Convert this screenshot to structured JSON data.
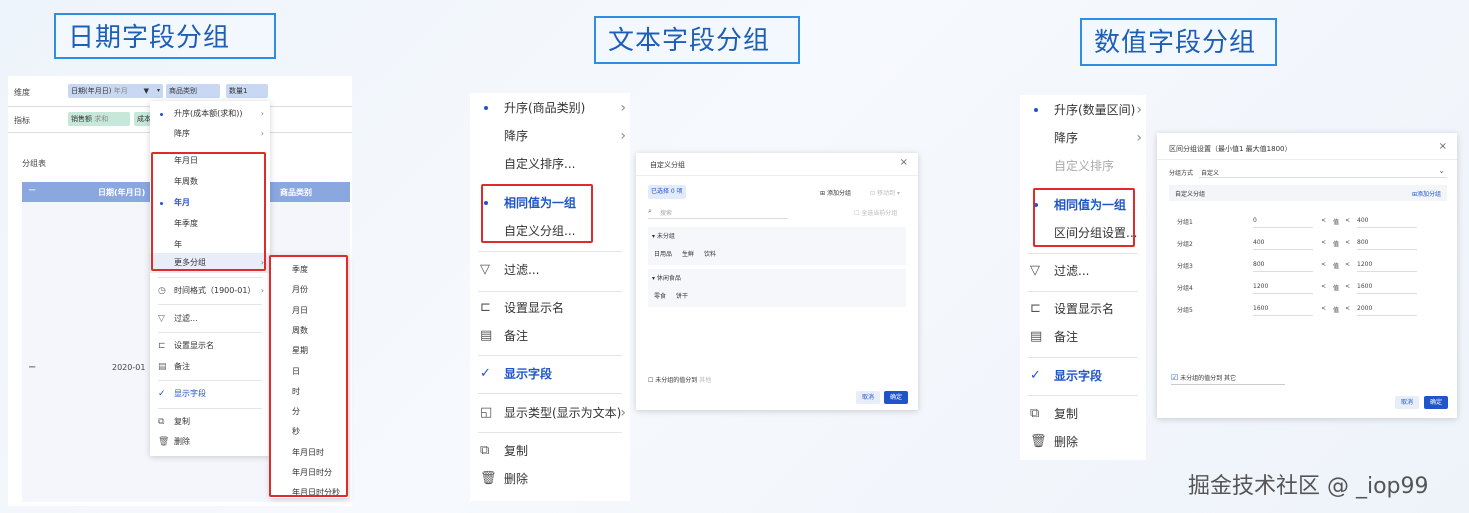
{
  "titles": {
    "date": "日期字段分组",
    "text": "文本字段分组",
    "number": "数值字段分组"
  },
  "watermark": "掘金技术社区 @ _iop99",
  "date_panel": {
    "dim_label": "维度",
    "measure_label": "指标",
    "field_date": "日期(年月日)",
    "field_date_sub": "年月",
    "field_cat": "商品类别",
    "field_qty": "数量1",
    "measure_sales": "销售额",
    "measure_sales_sub": "求和",
    "measure_cost": "成本",
    "group_table": "分组表",
    "table_minus": "−",
    "table_col1": "日期(年月日)",
    "table_col2": "商品类别",
    "row_minus": "−",
    "row_value": "2020-01",
    "menu": {
      "asc": "升序(成本额(求和))",
      "desc": "降序",
      "ymd": "年月日",
      "yw": "年周数",
      "ym": "年月",
      "yq": "年季度",
      "y": "年",
      "more": "更多分组",
      "time_fmt": "时间格式（1900-01）",
      "filter": "过滤...",
      "set_name": "设置显示名",
      "note": "备注",
      "show": "显示字段",
      "copy": "复制",
      "delete": "删除"
    },
    "submenu": [
      "季度",
      "月份",
      "月日",
      "周数",
      "星期",
      "日",
      "时",
      "分",
      "秒",
      "年月日时",
      "年月日时分",
      "年月日时分秒"
    ]
  },
  "text_panel": {
    "menu": {
      "asc": "升序(商品类别)",
      "desc": "降序",
      "custom_sort": "自定义排序...",
      "same_value": "相同值为一组",
      "custom_group": "自定义分组...",
      "filter": "过滤...",
      "set_name": "设置显示名",
      "note": "备注",
      "show": "显示字段",
      "display_type": "显示类型(显示为文本)",
      "copy": "复制",
      "delete": "删除"
    },
    "dialog": {
      "title": "自定义分组",
      "close": "×",
      "selected": "已选择 0 项",
      "add_group": "添加分组",
      "move_to": "移动到",
      "search_placeholder": "搜索",
      "select_all": "全选当前分组",
      "group1_name": "未分组",
      "group1_items": [
        "日用品",
        "生鲜",
        "饮料"
      ],
      "group2_name": "休闲食品",
      "group2_items": [
        "零食",
        "饼干"
      ],
      "ungrouped_check": "未分组的值分到",
      "ungrouped_value": "其他",
      "cancel": "取消",
      "ok": "确定"
    }
  },
  "number_panel": {
    "menu": {
      "asc": "升序(数量区间)",
      "desc": "降序",
      "custom_sort": "自定义排序",
      "same_value": "相同值为一组",
      "range_group": "区间分组设置...",
      "filter": "过滤...",
      "set_name": "设置显示名",
      "note": "备注",
      "show": "显示字段",
      "copy": "复制",
      "delete": "删除"
    },
    "dialog": {
      "title": "区间分组设置（最小值1 最大值1800）",
      "close": "×",
      "method_label": "分组方式",
      "method_value": "自定义",
      "custom_label": "自定义分组",
      "add_group": "添加分组",
      "rows": [
        {
          "name": "分组1",
          "from": "0",
          "op1": "<",
          "mid": "值",
          "op2": "<",
          "to": "400"
        },
        {
          "name": "分组2",
          "from": "400",
          "op1": "<",
          "mid": "值",
          "op2": "<",
          "to": "800"
        },
        {
          "name": "分组3",
          "from": "800",
          "op1": "<",
          "mid": "值",
          "op2": "<",
          "to": "1200"
        },
        {
          "name": "分组4",
          "from": "1200",
          "op1": "<",
          "mid": "值",
          "op2": "<",
          "to": "1600"
        },
        {
          "name": "分组5",
          "from": "1600",
          "op1": "<",
          "mid": "值",
          "op2": "<",
          "to": "2000"
        }
      ],
      "ungrouped_check": "未分组的值分到",
      "ungrouped_value": "其它",
      "cancel": "取消",
      "ok": "确定"
    }
  },
  "colors": {
    "accent": "#1f55c9",
    "title_border": "#2f8de4",
    "highlight": "#e02b2b",
    "table_header": "#8aa7e0"
  }
}
